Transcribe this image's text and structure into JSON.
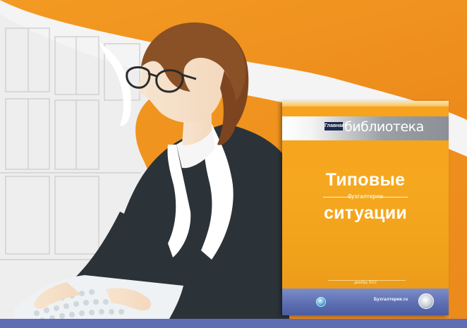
{
  "illustration": {
    "subject": "woman-at-computer"
  },
  "book": {
    "series_logo": "Главная",
    "series_title": "библиотека",
    "title_line1": "Типовые",
    "title_line2": "бухгалтерии",
    "title_line3": "ситуации",
    "footer_small": "декабрь 2012",
    "publisher": "Бухгалтерия.ru"
  },
  "colors": {
    "background_orange": "#f0901e",
    "book_orange": "#f5a81f",
    "jacket": "#2b3238",
    "hair": "#8a5026",
    "bottom_band": "#5d6fb2"
  }
}
